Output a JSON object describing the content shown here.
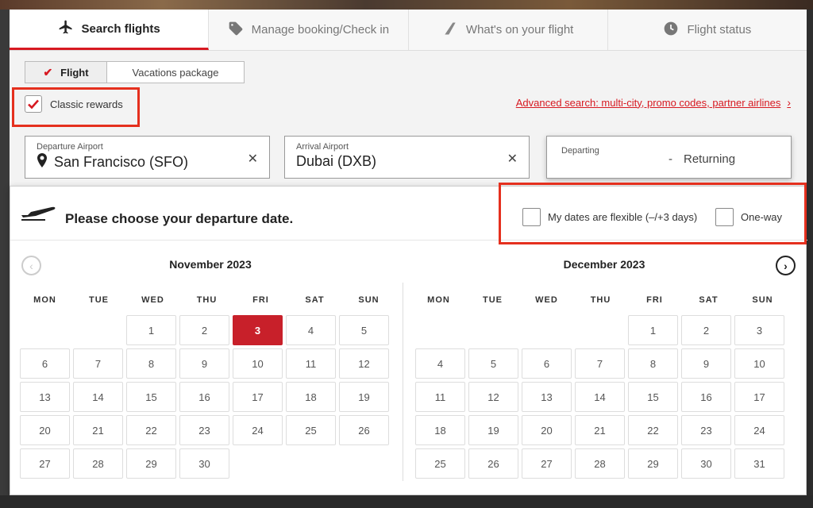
{
  "tabs": [
    {
      "label": "Search flights",
      "icon": "airplane-icon",
      "active": true
    },
    {
      "label": "Manage booking/Check in",
      "icon": "tag-icon",
      "active": false
    },
    {
      "label": "What's on your flight",
      "icon": "wing-icon",
      "active": false
    },
    {
      "label": "Flight status",
      "icon": "clock-icon",
      "active": false
    }
  ],
  "mode": {
    "flight_label": "Flight",
    "vacations_label": "Vacations package",
    "selected": "Flight"
  },
  "classic_rewards": {
    "label": "Classic rewards",
    "checked": true
  },
  "advanced_search": {
    "label": "Advanced search: multi-city, promo codes, partner airlines"
  },
  "departure": {
    "label": "Departure Airport",
    "value": "San Francisco (SFO)"
  },
  "arrival": {
    "label": "Arrival Airport",
    "value": "Dubai (DXB)"
  },
  "dates": {
    "departing_label": "Departing",
    "separator": "-",
    "returning_label": "Returning"
  },
  "calendar": {
    "prompt": "Please choose your departure date.",
    "flexible_label": "My dates are flexible (–/+3 days)",
    "oneway_label": "One-way",
    "weekdays": [
      "MON",
      "TUE",
      "WED",
      "THU",
      "FRI",
      "SAT",
      "SUN"
    ],
    "months": [
      {
        "title": "November 2023",
        "offset": 2,
        "days": 30,
        "selected": 3
      },
      {
        "title": "December 2023",
        "offset": 4,
        "days": 31,
        "selected": null
      }
    ]
  },
  "colors": {
    "accent": "#d71921",
    "highlight_box": "#e5301e",
    "selected_day": "#c8202a"
  }
}
